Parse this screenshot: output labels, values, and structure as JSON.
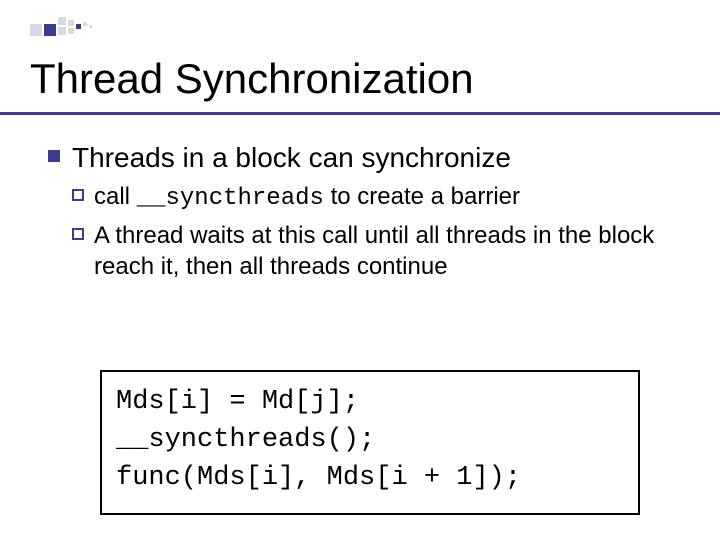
{
  "title": "Thread Synchronization",
  "bullet1": "Threads in a block can synchronize",
  "sub1_prefix": "call ",
  "sub1_code": "__syncthreads",
  "sub1_suffix": " to create a barrier",
  "sub2": "A thread waits at this call until all threads in the block reach it, then all threads continue",
  "code": {
    "line1": "Mds[i] = Md[j];",
    "line2": "__syncthreads();",
    "line3": "func(Mds[i], Mds[i + 1]);"
  }
}
